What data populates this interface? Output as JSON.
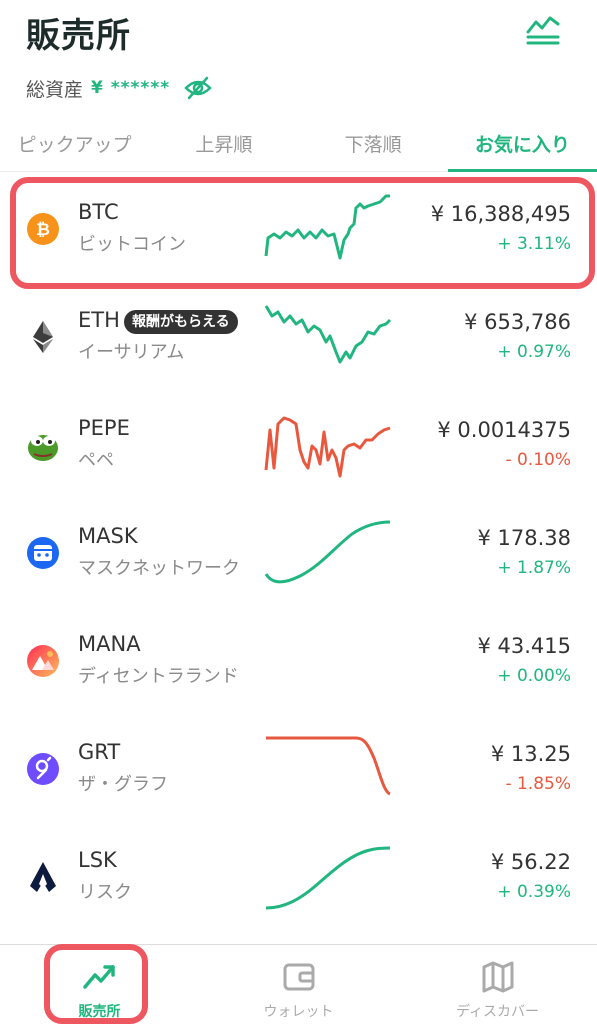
{
  "header": {
    "title": "販売所"
  },
  "assets": {
    "label": "総資産",
    "value": "¥ ******"
  },
  "tabs": [
    {
      "label": "ピックアップ"
    },
    {
      "label": "上昇順"
    },
    {
      "label": "下落順"
    },
    {
      "label": "お気に入り",
      "active": true
    }
  ],
  "coins": [
    {
      "symbol": "BTC",
      "name": "ビットコイン",
      "price": "¥ 16,388,495",
      "change": "+ 3.11%",
      "trend": "up",
      "icon": "bitcoin-icon",
      "color": "#f7931a"
    },
    {
      "symbol": "ETH",
      "name": "イーサリアム",
      "badge": "報酬がもらえる",
      "price": "¥ 653,786",
      "change": "+ 0.97%",
      "trend": "up",
      "icon": "ethereum-icon",
      "color": "#627eea"
    },
    {
      "symbol": "PEPE",
      "name": "ペペ",
      "price": "¥ 0.0014375",
      "change": "- 0.10%",
      "trend": "down",
      "icon": "pepe-icon",
      "color": "#4c9a2a"
    },
    {
      "symbol": "MASK",
      "name": "マスクネットワーク",
      "price": "¥ 178.38",
      "change": "+ 1.87%",
      "trend": "up",
      "icon": "mask-icon",
      "color": "#1c68f3"
    },
    {
      "symbol": "MANA",
      "name": "ディセントラランド",
      "price": "¥ 43.415",
      "change": "+ 0.00%",
      "trend": "up",
      "icon": "decentraland-icon",
      "color": "#ff2d55"
    },
    {
      "symbol": "GRT",
      "name": "ザ・グラフ",
      "price": "¥ 13.25",
      "change": "- 1.85%",
      "trend": "down",
      "icon": "graph-icon",
      "color": "#6f4cff"
    },
    {
      "symbol": "LSK",
      "name": "リスク",
      "price": "¥ 56.22",
      "change": "+ 0.39%",
      "trend": "up",
      "icon": "lisk-icon",
      "color": "#0d1b3e"
    }
  ],
  "nav": [
    {
      "label": "販売所",
      "icon": "trend-up-icon",
      "active": true
    },
    {
      "label": "ウォレット",
      "icon": "wallet-icon"
    },
    {
      "label": "ディスカバー",
      "icon": "map-icon"
    }
  ],
  "colors": {
    "accent": "#21b67f",
    "negative": "#e8583f",
    "highlight": "#ef5760"
  }
}
